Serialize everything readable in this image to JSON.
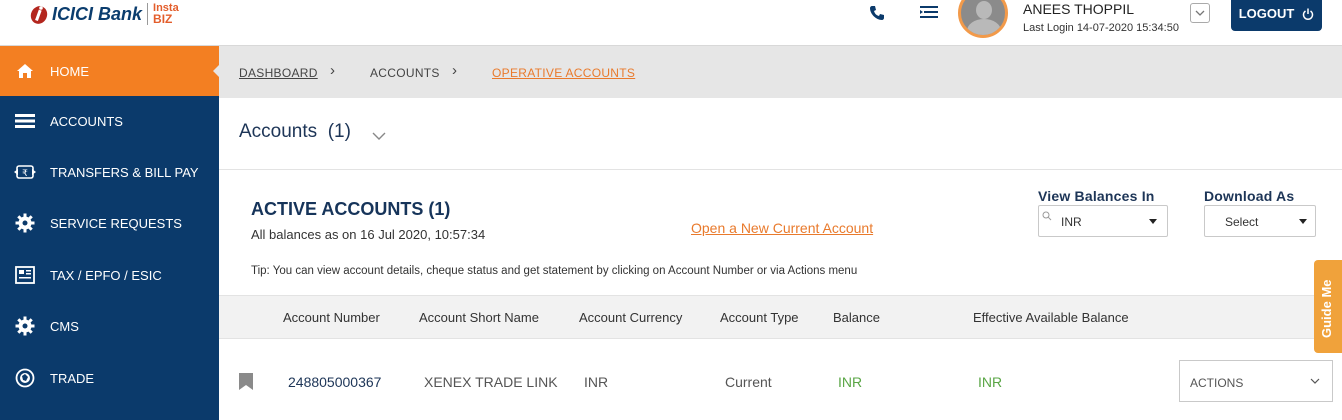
{
  "header": {
    "brand": "ICICI Bank",
    "brand_sub_line1": "Insta",
    "brand_sub_line2": "BIZ",
    "icons": [
      "phone-icon",
      "list-menu-icon"
    ],
    "user_name": "ANEES THOPPIL",
    "last_login": "Last Login 14-07-2020 15:34:50",
    "logout_label": "LOGOUT"
  },
  "sidebar": {
    "items": [
      {
        "label": "HOME",
        "icon": "home-icon",
        "active": true
      },
      {
        "label": "ACCOUNTS",
        "icon": "stack-icon"
      },
      {
        "label": "TRANSFERS & BILL PAY",
        "icon": "rupee-transfer-icon"
      },
      {
        "label": "SERVICE REQUESTS",
        "icon": "gear-icon"
      },
      {
        "label": "TAX / EPFO / ESIC",
        "icon": "receipt-icon"
      },
      {
        "label": "CMS",
        "icon": "gear-icon"
      },
      {
        "label": "TRADE",
        "icon": "globe-icon"
      }
    ]
  },
  "breadcrumb": [
    "DASHBOARD",
    "ACCOUNTS",
    "OPERATIVE ACCOUNTS"
  ],
  "main": {
    "title": "Accounts",
    "title_count": "(1)",
    "section_title": "ACTIVE ACCOUNTS (1)",
    "balances_as_on": "All balances as on 16 Jul 2020, 10:57:34",
    "open_account_link": "Open a New Current Account",
    "view_balances_label": "View Balances In",
    "view_balances_value": "INR",
    "download_label": "Download As",
    "download_value": "Select",
    "tip": "Tip: You can view account details, cheque status and get statement by clicking on Account Number or via Actions menu"
  },
  "table": {
    "columns": [
      "Account Number",
      "Account Short Name",
      "Account Currency",
      "Account Type",
      "Balance",
      "Effective Available Balance"
    ],
    "rows": [
      {
        "account_number": "248805000367",
        "short_name": "XENEX TRADE LINK",
        "currency": "INR",
        "type": "Current",
        "balance": "INR",
        "effective_balance": "INR",
        "actions": "ACTIONS"
      }
    ]
  },
  "guide_me": "Guide Me",
  "colors": {
    "primary": "#0b3a6b",
    "accent": "#f37f22",
    "link": "#e97a2c",
    "balance_green": "#5aa646"
  }
}
